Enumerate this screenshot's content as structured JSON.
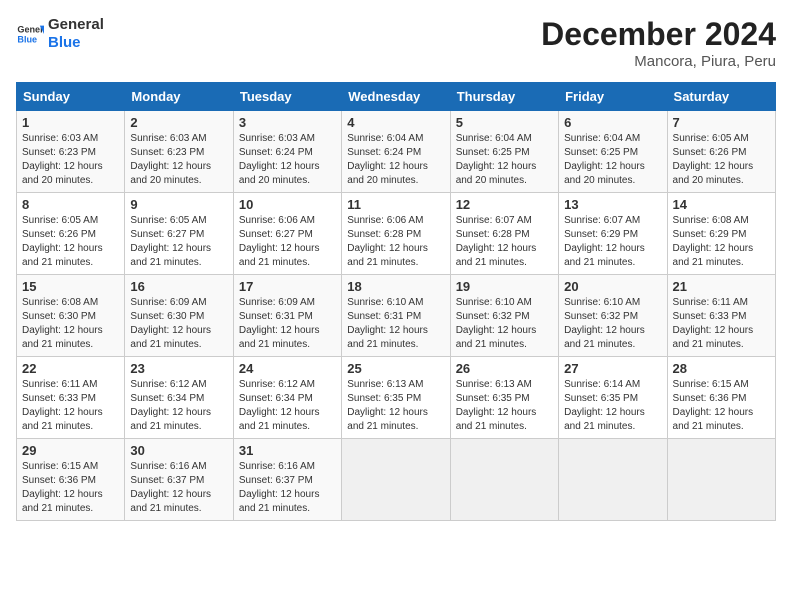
{
  "header": {
    "logo_line1": "General",
    "logo_line2": "Blue",
    "title": "December 2024",
    "subtitle": "Mancora, Piura, Peru"
  },
  "columns": [
    "Sunday",
    "Monday",
    "Tuesday",
    "Wednesday",
    "Thursday",
    "Friday",
    "Saturday"
  ],
  "weeks": [
    [
      {
        "day": "1",
        "info": "Sunrise: 6:03 AM\nSunset: 6:23 PM\nDaylight: 12 hours\nand 20 minutes."
      },
      {
        "day": "2",
        "info": "Sunrise: 6:03 AM\nSunset: 6:23 PM\nDaylight: 12 hours\nand 20 minutes."
      },
      {
        "day": "3",
        "info": "Sunrise: 6:03 AM\nSunset: 6:24 PM\nDaylight: 12 hours\nand 20 minutes."
      },
      {
        "day": "4",
        "info": "Sunrise: 6:04 AM\nSunset: 6:24 PM\nDaylight: 12 hours\nand 20 minutes."
      },
      {
        "day": "5",
        "info": "Sunrise: 6:04 AM\nSunset: 6:25 PM\nDaylight: 12 hours\nand 20 minutes."
      },
      {
        "day": "6",
        "info": "Sunrise: 6:04 AM\nSunset: 6:25 PM\nDaylight: 12 hours\nand 20 minutes."
      },
      {
        "day": "7",
        "info": "Sunrise: 6:05 AM\nSunset: 6:26 PM\nDaylight: 12 hours\nand 20 minutes."
      }
    ],
    [
      {
        "day": "8",
        "info": "Sunrise: 6:05 AM\nSunset: 6:26 PM\nDaylight: 12 hours\nand 21 minutes."
      },
      {
        "day": "9",
        "info": "Sunrise: 6:05 AM\nSunset: 6:27 PM\nDaylight: 12 hours\nand 21 minutes."
      },
      {
        "day": "10",
        "info": "Sunrise: 6:06 AM\nSunset: 6:27 PM\nDaylight: 12 hours\nand 21 minutes."
      },
      {
        "day": "11",
        "info": "Sunrise: 6:06 AM\nSunset: 6:28 PM\nDaylight: 12 hours\nand 21 minutes."
      },
      {
        "day": "12",
        "info": "Sunrise: 6:07 AM\nSunset: 6:28 PM\nDaylight: 12 hours\nand 21 minutes."
      },
      {
        "day": "13",
        "info": "Sunrise: 6:07 AM\nSunset: 6:29 PM\nDaylight: 12 hours\nand 21 minutes."
      },
      {
        "day": "14",
        "info": "Sunrise: 6:08 AM\nSunset: 6:29 PM\nDaylight: 12 hours\nand 21 minutes."
      }
    ],
    [
      {
        "day": "15",
        "info": "Sunrise: 6:08 AM\nSunset: 6:30 PM\nDaylight: 12 hours\nand 21 minutes."
      },
      {
        "day": "16",
        "info": "Sunrise: 6:09 AM\nSunset: 6:30 PM\nDaylight: 12 hours\nand 21 minutes."
      },
      {
        "day": "17",
        "info": "Sunrise: 6:09 AM\nSunset: 6:31 PM\nDaylight: 12 hours\nand 21 minutes."
      },
      {
        "day": "18",
        "info": "Sunrise: 6:10 AM\nSunset: 6:31 PM\nDaylight: 12 hours\nand 21 minutes."
      },
      {
        "day": "19",
        "info": "Sunrise: 6:10 AM\nSunset: 6:32 PM\nDaylight: 12 hours\nand 21 minutes."
      },
      {
        "day": "20",
        "info": "Sunrise: 6:10 AM\nSunset: 6:32 PM\nDaylight: 12 hours\nand 21 minutes."
      },
      {
        "day": "21",
        "info": "Sunrise: 6:11 AM\nSunset: 6:33 PM\nDaylight: 12 hours\nand 21 minutes."
      }
    ],
    [
      {
        "day": "22",
        "info": "Sunrise: 6:11 AM\nSunset: 6:33 PM\nDaylight: 12 hours\nand 21 minutes."
      },
      {
        "day": "23",
        "info": "Sunrise: 6:12 AM\nSunset: 6:34 PM\nDaylight: 12 hours\nand 21 minutes."
      },
      {
        "day": "24",
        "info": "Sunrise: 6:12 AM\nSunset: 6:34 PM\nDaylight: 12 hours\nand 21 minutes."
      },
      {
        "day": "25",
        "info": "Sunrise: 6:13 AM\nSunset: 6:35 PM\nDaylight: 12 hours\nand 21 minutes."
      },
      {
        "day": "26",
        "info": "Sunrise: 6:13 AM\nSunset: 6:35 PM\nDaylight: 12 hours\nand 21 minutes."
      },
      {
        "day": "27",
        "info": "Sunrise: 6:14 AM\nSunset: 6:35 PM\nDaylight: 12 hours\nand 21 minutes."
      },
      {
        "day": "28",
        "info": "Sunrise: 6:15 AM\nSunset: 6:36 PM\nDaylight: 12 hours\nand 21 minutes."
      }
    ],
    [
      {
        "day": "29",
        "info": "Sunrise: 6:15 AM\nSunset: 6:36 PM\nDaylight: 12 hours\nand 21 minutes."
      },
      {
        "day": "30",
        "info": "Sunrise: 6:16 AM\nSunset: 6:37 PM\nDaylight: 12 hours\nand 21 minutes."
      },
      {
        "day": "31",
        "info": "Sunrise: 6:16 AM\nSunset: 6:37 PM\nDaylight: 12 hours\nand 21 minutes."
      },
      {
        "day": "",
        "info": ""
      },
      {
        "day": "",
        "info": ""
      },
      {
        "day": "",
        "info": ""
      },
      {
        "day": "",
        "info": ""
      }
    ]
  ]
}
